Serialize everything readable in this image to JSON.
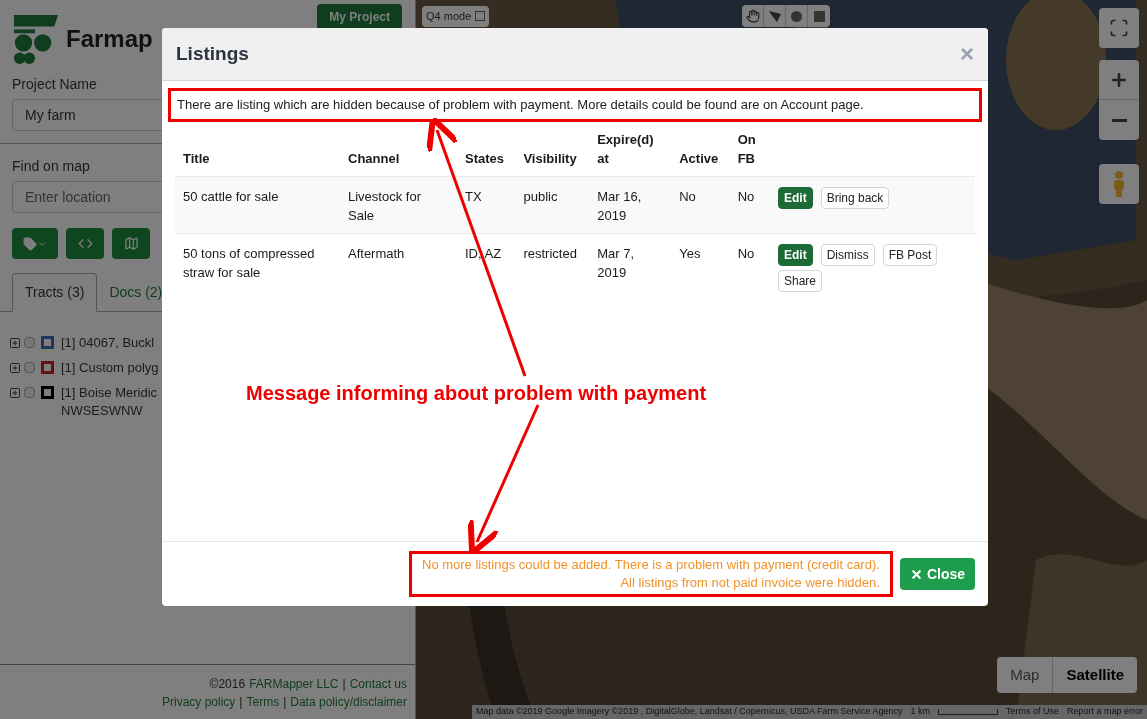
{
  "sidebar": {
    "logo_text": "Farmap",
    "my_project_button": "My Project",
    "project_name": {
      "label": "Project Name",
      "value": "My farm"
    },
    "find_on_map": {
      "label": "Find on map",
      "placeholder": "Enter location"
    },
    "tabs": [
      {
        "label": "Tracts (3)",
        "selected": true
      },
      {
        "label": "Docs  (2)",
        "selected": false
      }
    ],
    "tracts": [
      {
        "label": "[1] 04067, Buckl",
        "checked": false,
        "color": "#1d375a"
      },
      {
        "label": "[1] Custom polyg",
        "checked": false,
        "color": "#661111"
      },
      {
        "label": "[1] Boise Meridic",
        "label_line_2": "NWSESWNW",
        "checked": false,
        "color": "#000000"
      }
    ],
    "footer": {
      "copyright": "©2016",
      "company_link": "FARMapper LLC",
      "separator": "|",
      "contact_link": "Contact us",
      "links": [
        "Privacy policy",
        "Terms",
        "Data policy/disclaimer"
      ]
    }
  },
  "map": {
    "q4_mode": {
      "label": "Q4 mode",
      "checked": false
    },
    "map_types": [
      {
        "label": "Map",
        "selected": false
      },
      {
        "label": "Satellite",
        "selected": true
      }
    ],
    "attribution": [
      "Map data ©2019 Google Imagery ©2019 , DigitalGlobe, Landsat / Copernicus, USDA Farm Service Agency",
      "1 km",
      "Terms of Use",
      "Report a map error"
    ]
  },
  "modal": {
    "title": "Listings",
    "close_icon": "×",
    "notice": "There are listing which are hidden because of problem with payment. More details could be found are on Account page.",
    "table": {
      "columns": [
        "Title",
        "Channel",
        "States",
        "Visibility",
        "Expire(d) at",
        "Active",
        "On FB"
      ],
      "rows": [
        {
          "cells": [
            "50 cattle for sale",
            "Livestock for Sale",
            "TX",
            "public",
            "Mar 16, 2019",
            "No",
            "No"
          ],
          "actions": [
            {
              "label": "Edit",
              "kind": "primary"
            },
            {
              "label": "Bring back",
              "kind": "default"
            }
          ]
        },
        {
          "cells": [
            "50 tons of compressed straw for sale",
            "Aftermath",
            "ID, AZ",
            "restricted",
            "Mar 7, 2019",
            "Yes",
            "No"
          ],
          "actions": [
            {
              "label": "Edit",
              "kind": "primary"
            },
            {
              "label": "Dismiss",
              "kind": "default"
            },
            {
              "label": "FB Post",
              "kind": "default"
            },
            {
              "label": "Share",
              "kind": "default"
            }
          ]
        }
      ]
    },
    "footer_warning": [
      "No more listings could be added. There is a problem with payment (credit card).",
      "All listings from not paid invoice were hidden."
    ],
    "close_button": "Close"
  },
  "annotation": {
    "text": "Message informing about problem with payment"
  }
}
